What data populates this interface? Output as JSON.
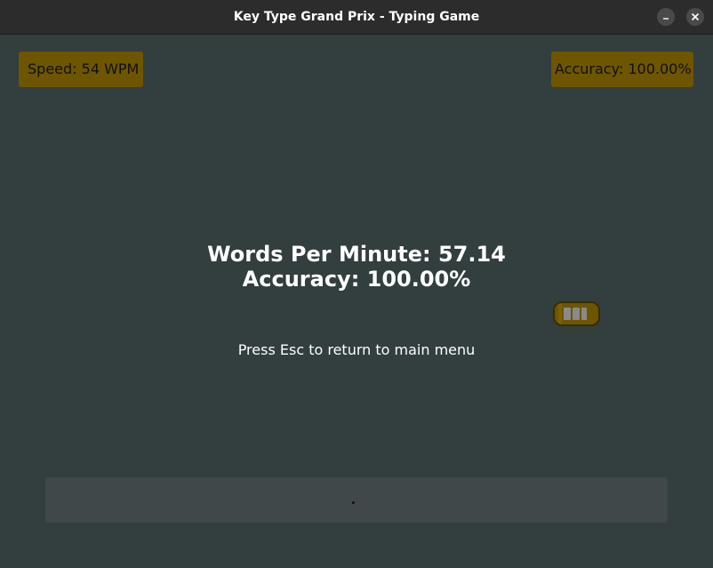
{
  "window": {
    "title": "Key Type Grand Prix - Typing Game",
    "minimize_label": "–",
    "close_label": "✕"
  },
  "hud": {
    "speed": "Speed: 54 WPM",
    "accuracy": "Accuracy: 100.00%"
  },
  "results": {
    "wpm": "Words Per Minute: 57.14",
    "accuracy": "Accuracy: 100.00%"
  },
  "hint": "Press Esc to return to main menu",
  "input": {
    "value": "."
  },
  "colors": {
    "background": "#333e3e",
    "hud_box": "#6e5500",
    "car_body": "#6e5500",
    "input_box": "#40484a"
  },
  "icons": {
    "minimize": "minimize-icon",
    "close": "close-icon",
    "car": "race-car-icon"
  }
}
